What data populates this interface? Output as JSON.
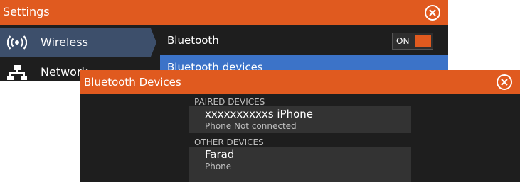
{
  "settings": {
    "title": "Settings",
    "sidebar": {
      "items": [
        {
          "label": "Wireless",
          "icon": "wireless-icon",
          "active": true
        },
        {
          "label": "Network",
          "icon": "network-icon",
          "active": false
        }
      ]
    },
    "rows": {
      "bluetooth_label": "Bluetooth",
      "bluetooth_toggle": "ON",
      "bluetooth_devices_label": "Bluetooth devices"
    }
  },
  "dialog": {
    "title": "Bluetooth Devices",
    "paired_header": "PAIRED DEVICES",
    "paired": [
      {
        "name": "xxxxxxxxxxs iPhone",
        "status": "Phone Not connected"
      }
    ],
    "other_header": "OTHER DEVICES",
    "other": [
      {
        "name": "Farad",
        "status": "Phone"
      }
    ]
  },
  "colors": {
    "accent": "#e05a1f",
    "highlight": "#3c73c8",
    "sidebar_active": "#3d4f6b",
    "background": "#1e1e1e"
  }
}
